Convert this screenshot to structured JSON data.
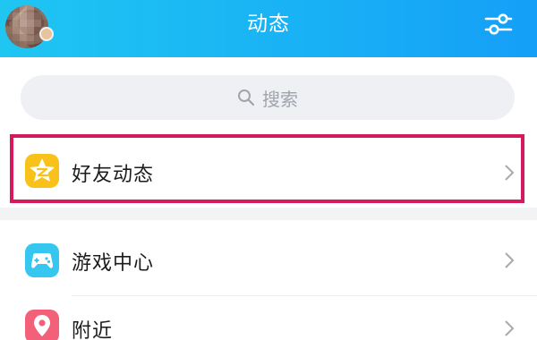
{
  "header": {
    "title": "动态"
  },
  "search": {
    "placeholder": "搜索"
  },
  "items": [
    {
      "label": "好友动态",
      "icon": "qzone-star-icon",
      "color": "#f9c21a"
    },
    {
      "label": "游戏中心",
      "icon": "gamepad-icon",
      "color": "#35c7f0"
    },
    {
      "label": "附近",
      "icon": "location-pin-icon",
      "color": "#f2607a"
    }
  ],
  "colors": {
    "header_start": "#1fc6f2",
    "header_end": "#159ff7",
    "highlight": "#d6195c"
  }
}
